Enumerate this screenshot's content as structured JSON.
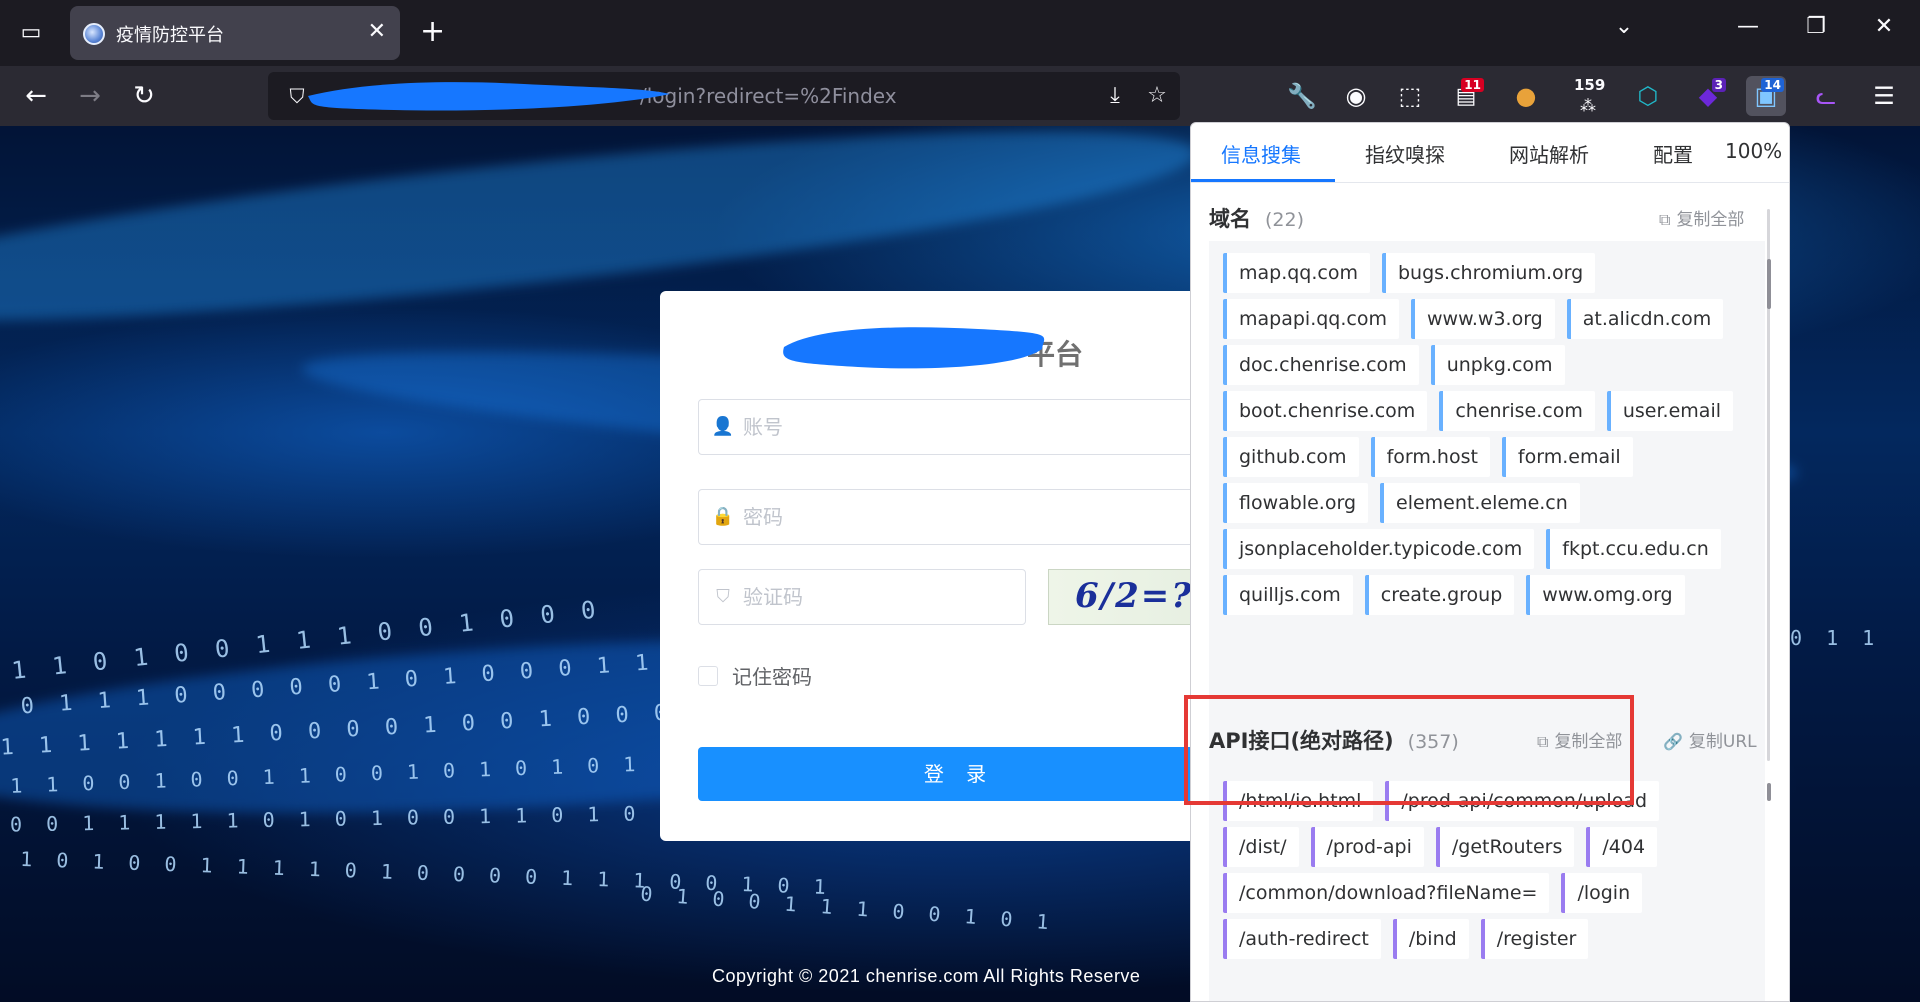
{
  "browser": {
    "tab": {
      "title": "疫情防控平台"
    },
    "url": {
      "visible_suffix": "/login?redirect=%2Findex"
    },
    "extensions": [
      {
        "name": "wrench-icon",
        "badge": ""
      },
      {
        "name": "account-icon",
        "badge": ""
      },
      {
        "name": "puzzle-icon",
        "badge": ""
      },
      {
        "name": "calendar-ext-icon",
        "badge": "11",
        "badge_color": "#d70022"
      },
      {
        "name": "cookie-icon",
        "badge": ""
      },
      {
        "name": "counter-ext-icon",
        "badge": "159",
        "badge_color": ""
      },
      {
        "name": "hex-ext-icon",
        "badge": ""
      },
      {
        "name": "gem-ext-icon",
        "badge": "3",
        "badge_color": "#5b21b6"
      },
      {
        "name": "findsomething-ext-icon",
        "badge": "14",
        "badge_color": "#1e63d6"
      },
      {
        "name": "cat-ext-icon",
        "badge": ""
      }
    ]
  },
  "login": {
    "title_suffix": "平台",
    "username_placeholder": "账号",
    "password_placeholder": "密码",
    "captcha_placeholder": "验证码",
    "captcha_text": "6/2=?",
    "remember_label": "记住密码",
    "login_button": "登 录",
    "footer": "Copyright © 2021 chenrise.com All Rights Reserve"
  },
  "popup": {
    "tabs": [
      "信息搜集",
      "指纹嗅探",
      "网站解析",
      "配置",
      "100%"
    ],
    "domains": {
      "title": "域名",
      "count": "(22)",
      "copy_all": "复制全部",
      "rows": [
        [
          "map.qq.com",
          "bugs.chromium.org"
        ],
        [
          "mapapi.qq.com",
          "www.w3.org",
          "at.alicdn.com"
        ],
        [
          "doc.chenrise.com",
          "unpkg.com"
        ],
        [
          "boot.chenrise.com",
          "chenrise.com",
          "user.email"
        ],
        [
          "github.com",
          "form.host",
          "form.email"
        ],
        [
          "flowable.org",
          "element.eleme.cn"
        ],
        [
          "jsonplaceholder.typicode.com",
          "fkpt.ccu.edu.cn"
        ],
        [
          "quilljs.com",
          "create.group",
          "www.omg.org"
        ]
      ]
    },
    "api": {
      "title": "API接口(绝对路径)",
      "count": "(357)",
      "copy_all": "复制全部",
      "copy_url": "复制URL",
      "rows": [
        [
          "/html/ie.html",
          "/prod-api/common/upload"
        ],
        [
          "/dist/",
          "/prod-api",
          "/getRouters",
          "/404"
        ],
        [
          "/common/download?fileName=",
          "/login"
        ],
        [
          "/auth-redirect",
          "/bind",
          "/register"
        ]
      ]
    }
  }
}
